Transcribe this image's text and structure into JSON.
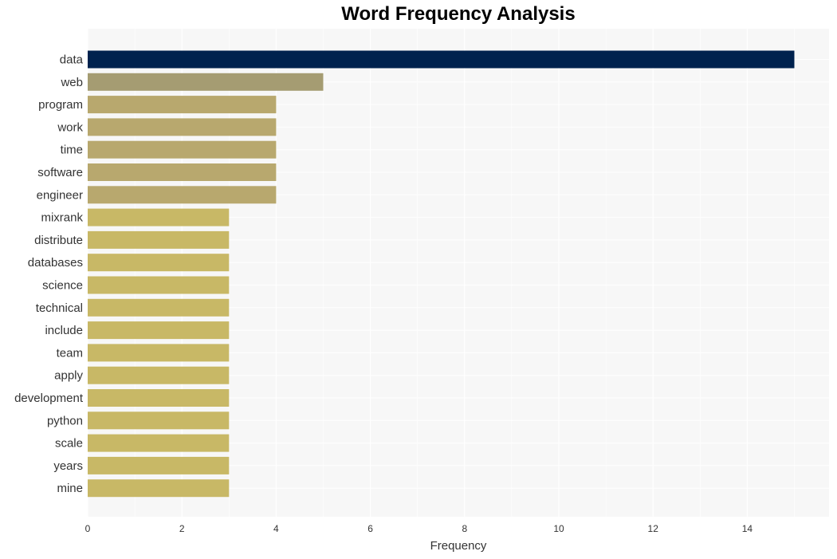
{
  "chart_data": {
    "type": "bar",
    "orientation": "horizontal",
    "title": "Word Frequency Analysis",
    "xlabel": "Frequency",
    "ylabel": "",
    "xlim": [
      0,
      15.7
    ],
    "xticks": [
      0,
      2,
      4,
      6,
      8,
      10,
      12,
      14
    ],
    "grid": true,
    "categories": [
      "data",
      "web",
      "program",
      "work",
      "time",
      "software",
      "engineer",
      "mixrank",
      "distribute",
      "databases",
      "science",
      "technical",
      "include",
      "team",
      "apply",
      "development",
      "python",
      "scale",
      "years",
      "mine"
    ],
    "values": [
      15,
      5,
      4,
      4,
      4,
      4,
      4,
      3,
      3,
      3,
      3,
      3,
      3,
      3,
      3,
      3,
      3,
      3,
      3,
      3
    ],
    "colors": [
      "#00224e",
      "#a59c72",
      "#b8a86e",
      "#b8a86e",
      "#b8a86e",
      "#b8a86e",
      "#b8a86e",
      "#c8b866",
      "#c8b866",
      "#c8b866",
      "#c8b866",
      "#c8b866",
      "#c8b866",
      "#c8b866",
      "#c8b866",
      "#c8b866",
      "#c8b866",
      "#c8b866",
      "#c8b866",
      "#c8b866"
    ]
  }
}
